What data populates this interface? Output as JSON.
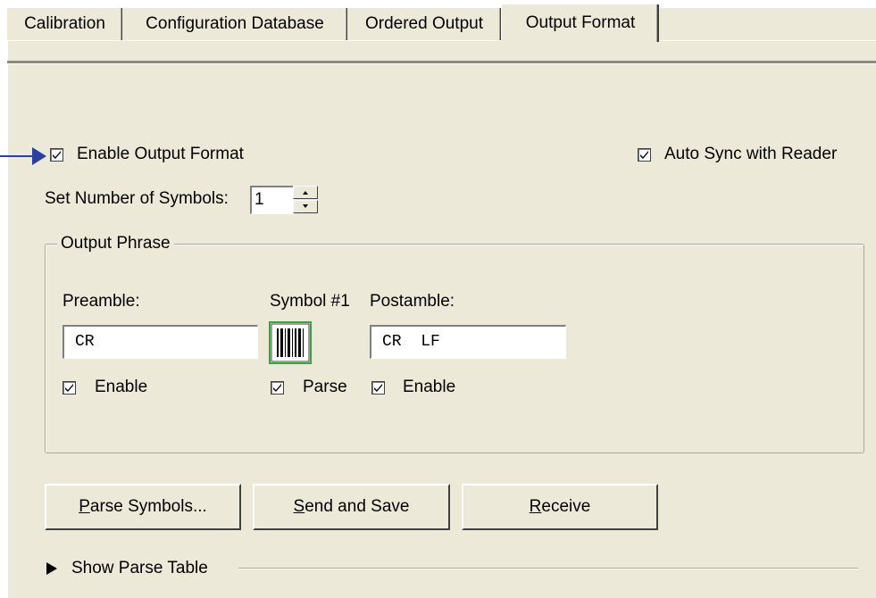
{
  "tabs": [
    {
      "label": "Calibration",
      "active": false
    },
    {
      "label": "Configuration Database",
      "active": false
    },
    {
      "label": "Ordered Output",
      "active": false
    },
    {
      "label": "Output Format",
      "active": true
    }
  ],
  "enable_output_format": {
    "label": "Enable Output Format",
    "checked": true
  },
  "auto_sync": {
    "label": "Auto Sync with Reader",
    "checked": true
  },
  "symbols": {
    "label": "Set Number of Symbols:",
    "value": "1"
  },
  "output_phrase": {
    "title": "Output Phrase",
    "preamble": {
      "label": "Preamble:",
      "value": "CR",
      "enable_label": "Enable",
      "enabled": true
    },
    "symbol": {
      "label": "Symbol #1",
      "parse_label": "Parse",
      "parse": true,
      "icon": "barcode-icon"
    },
    "postamble": {
      "label": "Postamble:",
      "value": "CR  LF",
      "enable_label": "Enable",
      "enabled": true
    }
  },
  "buttons": {
    "parse_symbols": {
      "mnemonic": "P",
      "rest": "arse Symbols..."
    },
    "send_and_save": {
      "mnemonic": "S",
      "rest": "end and Save"
    },
    "receive": {
      "mnemonic": "R",
      "rest": "eceive"
    }
  },
  "show_parse_table": {
    "label": "Show Parse Table"
  },
  "colors": {
    "panel": "#ece9d8",
    "arrow": "#2a3f9e",
    "barcode_border": "#3aa33a"
  }
}
